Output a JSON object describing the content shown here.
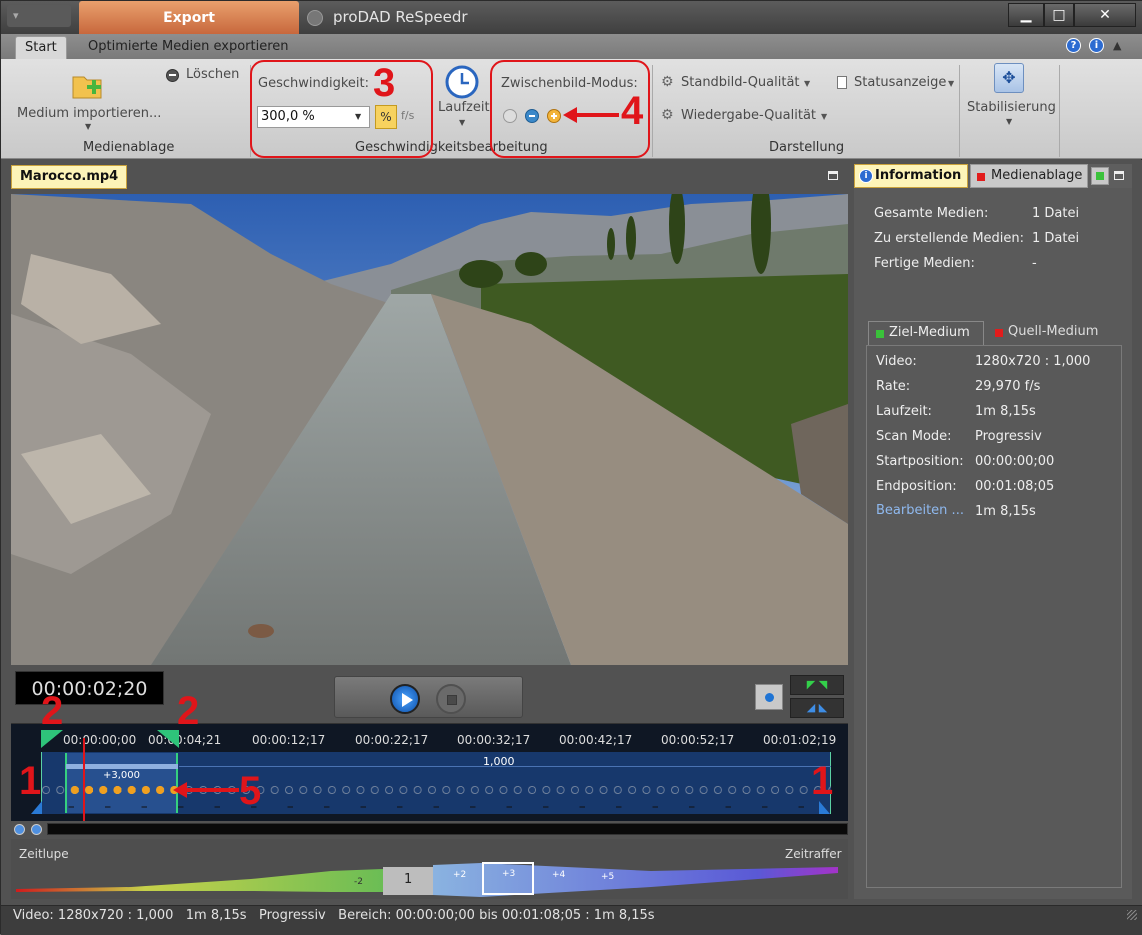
{
  "window": {
    "app_title": "proDAD ReSpeedr",
    "export_tab": "Export",
    "controls": {
      "minimize": "▁",
      "maximize": "□",
      "close": "✕"
    }
  },
  "ribbon_tabs": {
    "start": "Start",
    "export": "Optimierte Medien exportieren"
  },
  "ribbon": {
    "import_label": "Medium importieren...",
    "delete_label": "Löschen",
    "group_media": "Medienablage",
    "speed_label": "Geschwindigkeit:",
    "speed_value": "300,0 %",
    "percent_btn": "%",
    "fps_btn": "f/s",
    "runtime_label": "Laufzeit",
    "group_speed": "Geschwindigkeitsbearbeitung",
    "frame_mode_label": "Zwischenbild-Modus:",
    "still_quality": "Standbild-Qualität",
    "playback_quality": "Wiedergabe-Qualität",
    "status_display": "Statusanzeige",
    "group_display": "Darstellung",
    "stabilize": "Stabilisierung"
  },
  "annotations": [
    "3",
    "4",
    "2",
    "2",
    "1",
    "1",
    "5"
  ],
  "file_tab": "Marocco.mp4",
  "timecode": "00:00:02;20",
  "timeline": {
    "ticks": [
      "00:00:00;00",
      "00:00:04;21",
      "00:00:12;17",
      "00:00:22;17",
      "00:00:32;17",
      "00:00:42;17",
      "00:00:52;17",
      "00:01:02;19"
    ],
    "segment_speed": "+3,000",
    "rest_speed": "1,000"
  },
  "speed_curve": {
    "slow_label": "Zeitlupe",
    "fast_label": "Zeitraffer",
    "steps": [
      "-2",
      "1",
      "+2",
      "+3",
      "+4",
      "+5"
    ]
  },
  "right_panel": {
    "tab_info": "Information",
    "tab_media": "Medienablage",
    "rows": [
      {
        "label": "Gesamte Medien:",
        "value": "1 Datei"
      },
      {
        "label": "Zu erstellende Medien:",
        "value": "1 Datei"
      },
      {
        "label": "Fertige Medien:",
        "value": "-"
      }
    ],
    "subtab_target": "Ziel-Medium",
    "subtab_source": "Quell-Medium",
    "details": [
      {
        "label": "Video:",
        "value": "1280x720 : 1,000"
      },
      {
        "label": "Rate:",
        "value": "29,970 f/s"
      },
      {
        "label": "Laufzeit:",
        "value": "1m 8,15s"
      },
      {
        "label": "Scan Mode:",
        "value": "Progressiv"
      },
      {
        "label": "Startposition:",
        "value": "00:00:00;00"
      },
      {
        "label": "Endposition:",
        "value": "00:01:08;05"
      },
      {
        "label": "Bearbeiten ...",
        "value": "1m 8,15s"
      }
    ]
  },
  "status_bar": "Video: 1280x720 : 1,000   1m 8,15s   Progressiv   Bereich: 00:00:00;00 bis 00:01:08;05 : 1m 8,15s",
  "colors": {
    "accent_red": "#e0151a",
    "export_orange": "#d9804f",
    "timeline_blue": "#1f4f8f",
    "active_dot": "#f0a020"
  }
}
